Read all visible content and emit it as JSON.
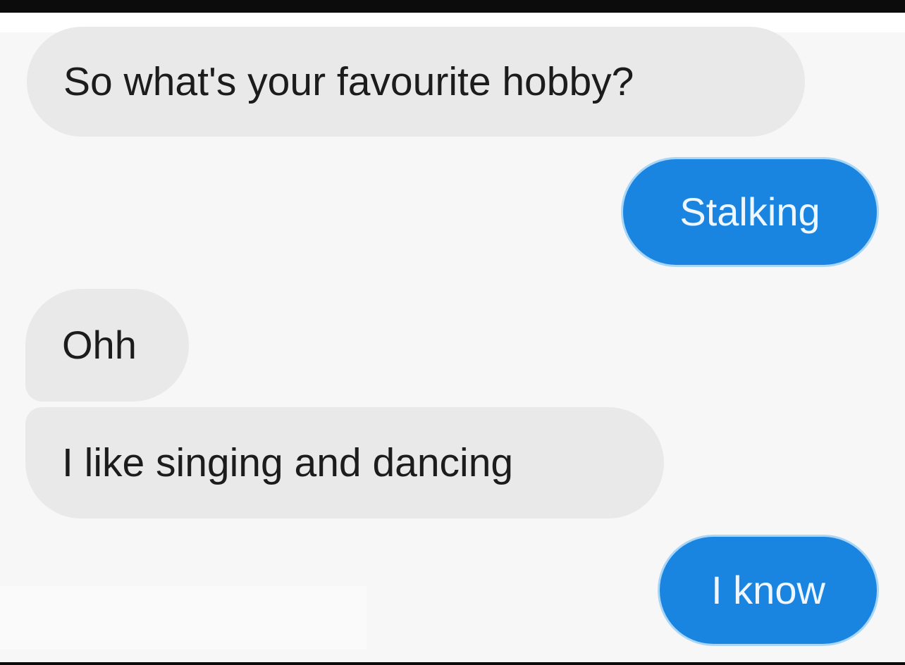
{
  "messages": [
    {
      "id": "msg-1",
      "direction": "incoming",
      "text": "So what's your favourite hobby?"
    },
    {
      "id": "msg-2",
      "direction": "outgoing",
      "text": "Stalking"
    },
    {
      "id": "msg-3",
      "direction": "incoming",
      "text": "Ohh"
    },
    {
      "id": "msg-4",
      "direction": "incoming",
      "text": "I like singing and dancing"
    },
    {
      "id": "msg-5",
      "direction": "outgoing",
      "text": "I know"
    }
  ],
  "colors": {
    "incoming_bubble": "#e9e9e9",
    "outgoing_bubble": "#1a85e0",
    "background": "#f7f7f7"
  }
}
